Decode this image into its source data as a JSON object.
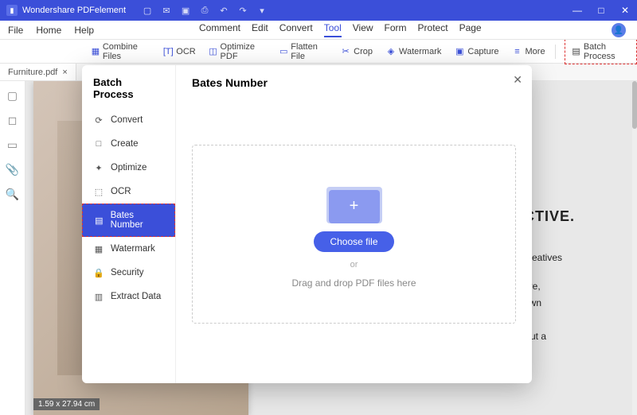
{
  "title": "Wondershare PDFelement",
  "menubar": {
    "items": [
      "File",
      "Home",
      "Help"
    ],
    "tabs": [
      "Comment",
      "Edit",
      "Convert",
      "Tool",
      "View",
      "Form",
      "Protect",
      "Page"
    ],
    "active_tab": "Tool"
  },
  "toolbar": {
    "combine": "Combine Files",
    "ocr": "OCR",
    "optimize": "Optimize PDF",
    "flatten": "Flatten File",
    "crop": "Crop",
    "watermark": "Watermark",
    "capture": "Capture",
    "more": "More",
    "batch": "Batch Process"
  },
  "filetab": {
    "name": "Furniture.pdf",
    "close": "×",
    "plus": "+"
  },
  "page_dims": "1.59 x 27.94 cm",
  "rightdoc": {
    "h1_frag": "CTIVE.",
    "p1": "creatives",
    "p2a": "ure,",
    "p2b": "own",
    "p3": "But a"
  },
  "modal": {
    "side_title": "Batch Process",
    "items": [
      {
        "icon": "convert",
        "label": "Convert"
      },
      {
        "icon": "create",
        "label": "Create"
      },
      {
        "icon": "optimize",
        "label": "Optimize"
      },
      {
        "icon": "ocr",
        "label": "OCR"
      },
      {
        "icon": "bates",
        "label": "Bates Number",
        "sel": true
      },
      {
        "icon": "watermark",
        "label": "Watermark"
      },
      {
        "icon": "security",
        "label": "Security"
      },
      {
        "icon": "extract",
        "label": "Extract Data"
      }
    ],
    "heading": "Bates Number",
    "choose": "Choose file",
    "or": "or",
    "dnd": "Drag and drop PDF files here"
  }
}
